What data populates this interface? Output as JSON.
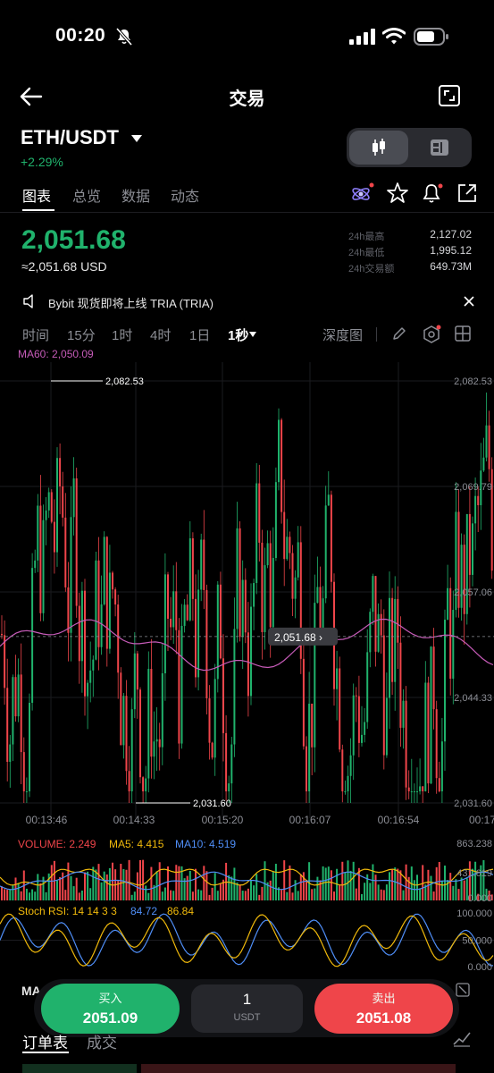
{
  "status_bar": {
    "time": "00:20",
    "icons": [
      "bell-slash-icon",
      "signal-icon",
      "wifi-icon",
      "battery-icon"
    ]
  },
  "nav": {
    "title": "交易",
    "back_icon": "back-arrow-icon",
    "expand_icon": "expand-icon"
  },
  "pair": {
    "symbol": "ETH/USDT",
    "change": "+2.29%",
    "caret_icon": "caret-down-icon"
  },
  "tabs": [
    {
      "label": "图表",
      "active": true
    },
    {
      "label": "总览",
      "active": false
    },
    {
      "label": "数据",
      "active": false
    },
    {
      "label": "动态",
      "active": false
    }
  ],
  "price": {
    "last": "2,051.68",
    "usd": "≈2,051.68 USD"
  },
  "stats": [
    {
      "label": "24h最高",
      "value": "2,127.02"
    },
    {
      "label": "24h最低",
      "value": "1,995.12"
    },
    {
      "label": "24h交易额",
      "value": "649.73M"
    }
  ],
  "notice": {
    "text": "Bybit 现货即将上线 TRIA (TRIA)",
    "speaker_icon": "speaker-icon",
    "close_icon": "close-icon"
  },
  "intervals": [
    {
      "label": "时间",
      "active": false
    },
    {
      "label": "15分",
      "active": false
    },
    {
      "label": "1时",
      "active": false
    },
    {
      "label": "4时",
      "active": false
    },
    {
      "label": "1日",
      "active": false
    },
    {
      "label": "1秒",
      "active": true
    }
  ],
  "depth_label": "深度图",
  "colors": {
    "up": "#20b26c",
    "down": "#ef454a",
    "ma60": "#c65bb8",
    "ma5": "#f0b90b",
    "ma10": "#4f8ef7"
  },
  "main_chart": {
    "ma60_label": "MA60: 2,050.09",
    "y_axis": [
      "2,082.53",
      "2,069.79",
      "2,057.06",
      "2,044.33",
      "2,031.60"
    ],
    "high_marker": "2,082.53",
    "low_marker": "2,031.60",
    "last_price_tag": "2,051.68",
    "x_axis": [
      "00:13:46",
      "00:14:33",
      "00:15:20",
      "00:16:07",
      "00:16:54",
      "00:17"
    ]
  },
  "volume": {
    "label": "VOLUME: 2.249",
    "ma5_label": "MA5: 4.415",
    "ma10_label": "MA10: 4.519",
    "y_axis": [
      "863.238",
      "431.619",
      "0.000"
    ]
  },
  "stoch_rsi": {
    "label": "Stoch RSI: 14 14 3 3",
    "k": "84.72",
    "d": "86.84",
    "y_axis": [
      "100.000",
      "50.000",
      "0.000"
    ]
  },
  "trade_bar": {
    "buy_label": "买入",
    "buy_price": "2051.09",
    "qty": "1",
    "qty_unit": "USDT",
    "sell_label": "卖出",
    "sell_price": "2051.08",
    "ma_cut": "MA"
  },
  "order_tabs": [
    {
      "label": "订单表",
      "active": true
    },
    {
      "label": "成交",
      "active": false
    }
  ]
}
